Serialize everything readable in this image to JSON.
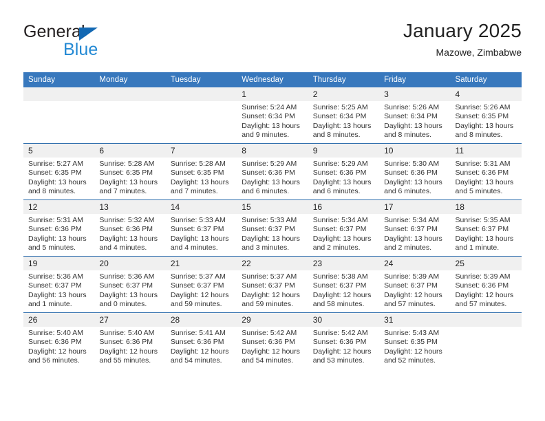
{
  "brand": {
    "name_top": "General",
    "name_bottom": "Blue"
  },
  "header": {
    "title": "January 2025",
    "subtitle": "Mazowe, Zimbabwe"
  },
  "colors": {
    "header_blue": "#3878bd",
    "row_divider_blue": "#2f6ead",
    "daynum_band": "#f0f0f0",
    "logo_blue": "#2389d4",
    "logo_triangle": "#1268b3"
  },
  "weekday_headers": [
    "Sunday",
    "Monday",
    "Tuesday",
    "Wednesday",
    "Thursday",
    "Friday",
    "Saturday"
  ],
  "weeks": [
    [
      {
        "day": "",
        "sunrise": "",
        "sunset": "",
        "daylight": "",
        "empty": true
      },
      {
        "day": "",
        "sunrise": "",
        "sunset": "",
        "daylight": "",
        "empty": true
      },
      {
        "day": "",
        "sunrise": "",
        "sunset": "",
        "daylight": "",
        "empty": true
      },
      {
        "day": "1",
        "sunrise": "Sunrise: 5:24 AM",
        "sunset": "Sunset: 6:34 PM",
        "daylight": "Daylight: 13 hours and 9 minutes.",
        "empty": false
      },
      {
        "day": "2",
        "sunrise": "Sunrise: 5:25 AM",
        "sunset": "Sunset: 6:34 PM",
        "daylight": "Daylight: 13 hours and 8 minutes.",
        "empty": false
      },
      {
        "day": "3",
        "sunrise": "Sunrise: 5:26 AM",
        "sunset": "Sunset: 6:34 PM",
        "daylight": "Daylight: 13 hours and 8 minutes.",
        "empty": false
      },
      {
        "day": "4",
        "sunrise": "Sunrise: 5:26 AM",
        "sunset": "Sunset: 6:35 PM",
        "daylight": "Daylight: 13 hours and 8 minutes.",
        "empty": false
      }
    ],
    [
      {
        "day": "5",
        "sunrise": "Sunrise: 5:27 AM",
        "sunset": "Sunset: 6:35 PM",
        "daylight": "Daylight: 13 hours and 8 minutes.",
        "empty": false
      },
      {
        "day": "6",
        "sunrise": "Sunrise: 5:28 AM",
        "sunset": "Sunset: 6:35 PM",
        "daylight": "Daylight: 13 hours and 7 minutes.",
        "empty": false
      },
      {
        "day": "7",
        "sunrise": "Sunrise: 5:28 AM",
        "sunset": "Sunset: 6:35 PM",
        "daylight": "Daylight: 13 hours and 7 minutes.",
        "empty": false
      },
      {
        "day": "8",
        "sunrise": "Sunrise: 5:29 AM",
        "sunset": "Sunset: 6:36 PM",
        "daylight": "Daylight: 13 hours and 6 minutes.",
        "empty": false
      },
      {
        "day": "9",
        "sunrise": "Sunrise: 5:29 AM",
        "sunset": "Sunset: 6:36 PM",
        "daylight": "Daylight: 13 hours and 6 minutes.",
        "empty": false
      },
      {
        "day": "10",
        "sunrise": "Sunrise: 5:30 AM",
        "sunset": "Sunset: 6:36 PM",
        "daylight": "Daylight: 13 hours and 6 minutes.",
        "empty": false
      },
      {
        "day": "11",
        "sunrise": "Sunrise: 5:31 AM",
        "sunset": "Sunset: 6:36 PM",
        "daylight": "Daylight: 13 hours and 5 minutes.",
        "empty": false
      }
    ],
    [
      {
        "day": "12",
        "sunrise": "Sunrise: 5:31 AM",
        "sunset": "Sunset: 6:36 PM",
        "daylight": "Daylight: 13 hours and 5 minutes.",
        "empty": false
      },
      {
        "day": "13",
        "sunrise": "Sunrise: 5:32 AM",
        "sunset": "Sunset: 6:36 PM",
        "daylight": "Daylight: 13 hours and 4 minutes.",
        "empty": false
      },
      {
        "day": "14",
        "sunrise": "Sunrise: 5:33 AM",
        "sunset": "Sunset: 6:37 PM",
        "daylight": "Daylight: 13 hours and 4 minutes.",
        "empty": false
      },
      {
        "day": "15",
        "sunrise": "Sunrise: 5:33 AM",
        "sunset": "Sunset: 6:37 PM",
        "daylight": "Daylight: 13 hours and 3 minutes.",
        "empty": false
      },
      {
        "day": "16",
        "sunrise": "Sunrise: 5:34 AM",
        "sunset": "Sunset: 6:37 PM",
        "daylight": "Daylight: 13 hours and 2 minutes.",
        "empty": false
      },
      {
        "day": "17",
        "sunrise": "Sunrise: 5:34 AM",
        "sunset": "Sunset: 6:37 PM",
        "daylight": "Daylight: 13 hours and 2 minutes.",
        "empty": false
      },
      {
        "day": "18",
        "sunrise": "Sunrise: 5:35 AM",
        "sunset": "Sunset: 6:37 PM",
        "daylight": "Daylight: 13 hours and 1 minute.",
        "empty": false
      }
    ],
    [
      {
        "day": "19",
        "sunrise": "Sunrise: 5:36 AM",
        "sunset": "Sunset: 6:37 PM",
        "daylight": "Daylight: 13 hours and 1 minute.",
        "empty": false
      },
      {
        "day": "20",
        "sunrise": "Sunrise: 5:36 AM",
        "sunset": "Sunset: 6:37 PM",
        "daylight": "Daylight: 13 hours and 0 minutes.",
        "empty": false
      },
      {
        "day": "21",
        "sunrise": "Sunrise: 5:37 AM",
        "sunset": "Sunset: 6:37 PM",
        "daylight": "Daylight: 12 hours and 59 minutes.",
        "empty": false
      },
      {
        "day": "22",
        "sunrise": "Sunrise: 5:37 AM",
        "sunset": "Sunset: 6:37 PM",
        "daylight": "Daylight: 12 hours and 59 minutes.",
        "empty": false
      },
      {
        "day": "23",
        "sunrise": "Sunrise: 5:38 AM",
        "sunset": "Sunset: 6:37 PM",
        "daylight": "Daylight: 12 hours and 58 minutes.",
        "empty": false
      },
      {
        "day": "24",
        "sunrise": "Sunrise: 5:39 AM",
        "sunset": "Sunset: 6:37 PM",
        "daylight": "Daylight: 12 hours and 57 minutes.",
        "empty": false
      },
      {
        "day": "25",
        "sunrise": "Sunrise: 5:39 AM",
        "sunset": "Sunset: 6:36 PM",
        "daylight": "Daylight: 12 hours and 57 minutes.",
        "empty": false
      }
    ],
    [
      {
        "day": "26",
        "sunrise": "Sunrise: 5:40 AM",
        "sunset": "Sunset: 6:36 PM",
        "daylight": "Daylight: 12 hours and 56 minutes.",
        "empty": false
      },
      {
        "day": "27",
        "sunrise": "Sunrise: 5:40 AM",
        "sunset": "Sunset: 6:36 PM",
        "daylight": "Daylight: 12 hours and 55 minutes.",
        "empty": false
      },
      {
        "day": "28",
        "sunrise": "Sunrise: 5:41 AM",
        "sunset": "Sunset: 6:36 PM",
        "daylight": "Daylight: 12 hours and 54 minutes.",
        "empty": false
      },
      {
        "day": "29",
        "sunrise": "Sunrise: 5:42 AM",
        "sunset": "Sunset: 6:36 PM",
        "daylight": "Daylight: 12 hours and 54 minutes.",
        "empty": false
      },
      {
        "day": "30",
        "sunrise": "Sunrise: 5:42 AM",
        "sunset": "Sunset: 6:36 PM",
        "daylight": "Daylight: 12 hours and 53 minutes.",
        "empty": false
      },
      {
        "day": "31",
        "sunrise": "Sunrise: 5:43 AM",
        "sunset": "Sunset: 6:35 PM",
        "daylight": "Daylight: 12 hours and 52 minutes.",
        "empty": false
      },
      {
        "day": "",
        "sunrise": "",
        "sunset": "",
        "daylight": "",
        "empty": true
      }
    ]
  ]
}
